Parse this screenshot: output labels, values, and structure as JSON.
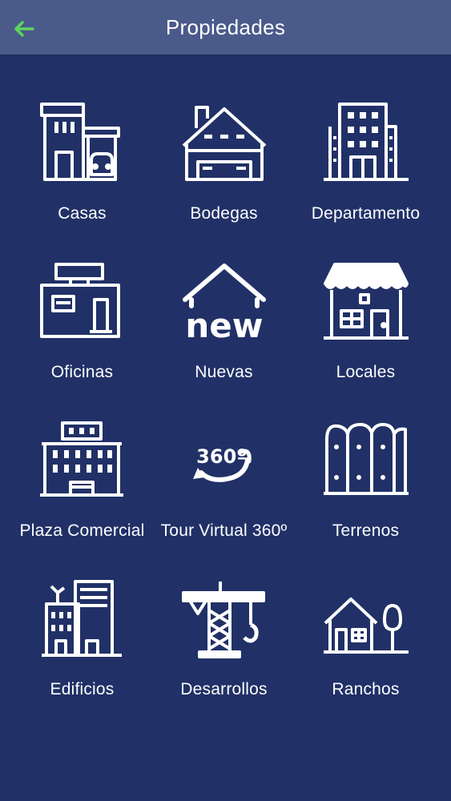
{
  "header": {
    "title": "Propiedades",
    "back_icon": "arrow-left-icon",
    "back_color": "#5cd65c"
  },
  "colors": {
    "background": "#213167",
    "header": "#4a5a8a",
    "icon": "#ffffff"
  },
  "items": [
    {
      "label": "Casas",
      "icon": "house-garage-icon"
    },
    {
      "label": "Bodegas",
      "icon": "warehouse-icon"
    },
    {
      "label": "Departamento",
      "icon": "apartment-building-icon"
    },
    {
      "label": "Oficinas",
      "icon": "office-icon"
    },
    {
      "label": "Nuevas",
      "icon": "new-house-icon",
      "icon_text": "new"
    },
    {
      "label": "Locales",
      "icon": "shop-icon"
    },
    {
      "label": "Plaza Comercial",
      "icon": "shopping-plaza-icon"
    },
    {
      "label": "Tour Virtual 360º",
      "icon": "tour-360-icon",
      "icon_text": "360º"
    },
    {
      "label": "Terrenos",
      "icon": "fence-icon"
    },
    {
      "label": "Edificios",
      "icon": "buildings-icon"
    },
    {
      "label": "Desarrollos",
      "icon": "construction-crane-icon"
    },
    {
      "label": "Ranchos",
      "icon": "ranch-icon"
    }
  ]
}
